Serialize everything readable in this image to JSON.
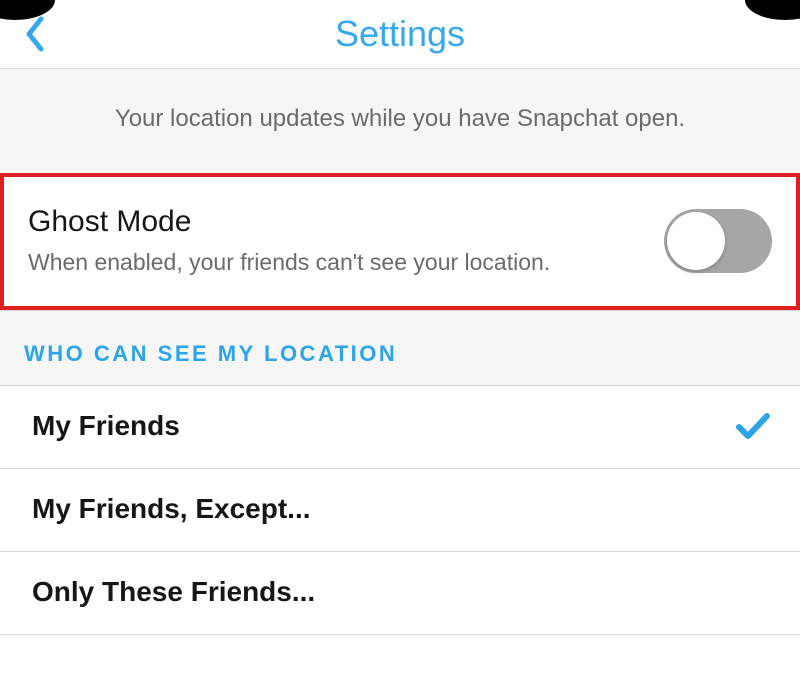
{
  "header": {
    "title": "Settings"
  },
  "info_banner": "Your location updates while you have Snapchat open.",
  "ghost_mode": {
    "title": "Ghost Mode",
    "description": "When enabled, your friends can't see your location.",
    "enabled": false
  },
  "section_header": "WHO CAN SEE MY LOCATION",
  "options": [
    {
      "label": "My Friends",
      "selected": true
    },
    {
      "label": "My Friends, Except...",
      "selected": false
    },
    {
      "label": "Only These Friends...",
      "selected": false
    }
  ],
  "colors": {
    "accent": "#37a8ee",
    "highlight": "#e02020"
  }
}
